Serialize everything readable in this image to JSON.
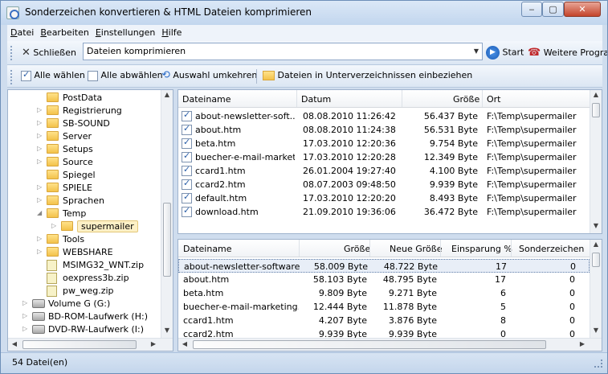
{
  "window": {
    "title": "Sonderzeichen konvertieren & HTML Dateien komprimieren"
  },
  "menu": [
    "Datei",
    "Bearbeiten",
    "Einstellungen",
    "Hilfe"
  ],
  "toolbar1": {
    "close_label": "Schließen",
    "combo_value": "Dateien komprimieren",
    "start_label": "Start",
    "more_label": "Weitere Progra"
  },
  "toolbar2": {
    "select_all": "Alle wählen",
    "deselect_all": "Alle abwählen",
    "invert": "Auswahl umkehren",
    "subdirs": "Dateien in Unterverzeichnissen einbeziehen"
  },
  "tree": [
    {
      "label": "PostData",
      "type": "folder",
      "arrow": false,
      "indent": 2
    },
    {
      "label": "Registrierung",
      "type": "folder",
      "arrow": true,
      "indent": 2
    },
    {
      "label": "SB-SOUND",
      "type": "folder",
      "arrow": true,
      "indent": 2
    },
    {
      "label": "Server",
      "type": "folder",
      "arrow": true,
      "indent": 2
    },
    {
      "label": "Setups",
      "type": "folder",
      "arrow": true,
      "indent": 2
    },
    {
      "label": "Source",
      "type": "folder",
      "arrow": true,
      "indent": 2
    },
    {
      "label": "Spiegel",
      "type": "folder",
      "arrow": false,
      "indent": 2
    },
    {
      "label": "SPIELE",
      "type": "folder",
      "arrow": true,
      "indent": 2
    },
    {
      "label": "Sprachen",
      "type": "folder",
      "arrow": true,
      "indent": 2
    },
    {
      "label": "Temp",
      "type": "folder",
      "arrow": true,
      "indent": 2
    },
    {
      "label": "supermailer",
      "type": "folder",
      "arrow": true,
      "indent": 3,
      "selected": true
    },
    {
      "label": "Tools",
      "type": "folder",
      "arrow": true,
      "indent": 2
    },
    {
      "label": "WEBSHARE",
      "type": "folder",
      "arrow": true,
      "indent": 2
    },
    {
      "label": "MSIMG32_WNT.zip",
      "type": "file",
      "arrow": false,
      "indent": 2
    },
    {
      "label": "oexpress3b.zip",
      "type": "file",
      "arrow": false,
      "indent": 2
    },
    {
      "label": "pw_weg.zip",
      "type": "file",
      "arrow": false,
      "indent": 2
    },
    {
      "label": "Volume G (G:)",
      "type": "drive",
      "arrow": true,
      "indent": 1
    },
    {
      "label": "BD-ROM-Laufwerk (H:)",
      "type": "drive",
      "arrow": true,
      "indent": 1
    },
    {
      "label": "DVD-RW-Laufwerk (I:)",
      "type": "drive",
      "arrow": true,
      "indent": 1
    }
  ],
  "files_table": {
    "columns": [
      "Dateiname",
      "Datum",
      "Größe",
      "Ort"
    ],
    "rows": [
      {
        "name": "about-newsletter-soft...",
        "date": "08.08.2010 11:26:42",
        "size": "56.437 Byte",
        "loc": "F:\\Temp\\supermailer",
        "checked": true
      },
      {
        "name": "about.htm",
        "date": "08.08.2010 11:24:38",
        "size": "56.531 Byte",
        "loc": "F:\\Temp\\supermailer",
        "checked": true
      },
      {
        "name": "beta.htm",
        "date": "17.03.2010 12:20:36",
        "size": "9.754 Byte",
        "loc": "F:\\Temp\\supermailer",
        "checked": true
      },
      {
        "name": "buecher-e-mail-marketi...",
        "date": "17.03.2010 12:20:28",
        "size": "12.349 Byte",
        "loc": "F:\\Temp\\supermailer",
        "checked": true
      },
      {
        "name": "ccard1.htm",
        "date": "26.01.2004 19:27:40",
        "size": "4.100 Byte",
        "loc": "F:\\Temp\\supermailer",
        "checked": true
      },
      {
        "name": "ccard2.htm",
        "date": "08.07.2003 09:48:50",
        "size": "9.939 Byte",
        "loc": "F:\\Temp\\supermailer",
        "checked": true
      },
      {
        "name": "default.htm",
        "date": "17.03.2010 12:20:20",
        "size": "8.493 Byte",
        "loc": "F:\\Temp\\supermailer",
        "checked": true
      },
      {
        "name": "download.htm",
        "date": "21.09.2010 19:36:06",
        "size": "36.472 Byte",
        "loc": "F:\\Temp\\supermailer",
        "checked": true
      }
    ]
  },
  "results_table": {
    "columns": [
      "Dateiname",
      "Größe",
      "Neue Größe",
      "Einsparung %",
      "Sonderzeichen"
    ],
    "rows": [
      {
        "name": "about-newsletter-software....",
        "size": "58.009 Byte",
        "new": "48.722 Byte",
        "save": "17",
        "special": "0",
        "selected": true
      },
      {
        "name": "about.htm",
        "size": "58.103 Byte",
        "new": "48.795 Byte",
        "save": "17",
        "special": "0"
      },
      {
        "name": "beta.htm",
        "size": "9.809 Byte",
        "new": "9.271 Byte",
        "save": "6",
        "special": "0"
      },
      {
        "name": "buecher-e-mail-marketing....",
        "size": "12.444 Byte",
        "new": "11.878 Byte",
        "save": "5",
        "special": "0"
      },
      {
        "name": "ccard1.htm",
        "size": "4.207 Byte",
        "new": "3.876 Byte",
        "save": "8",
        "special": "0"
      },
      {
        "name": "ccard2.htm",
        "size": "9.939 Byte",
        "new": "9.939 Byte",
        "save": "0",
        "special": "0"
      }
    ]
  },
  "status": {
    "text": "54 Datei(en)"
  }
}
